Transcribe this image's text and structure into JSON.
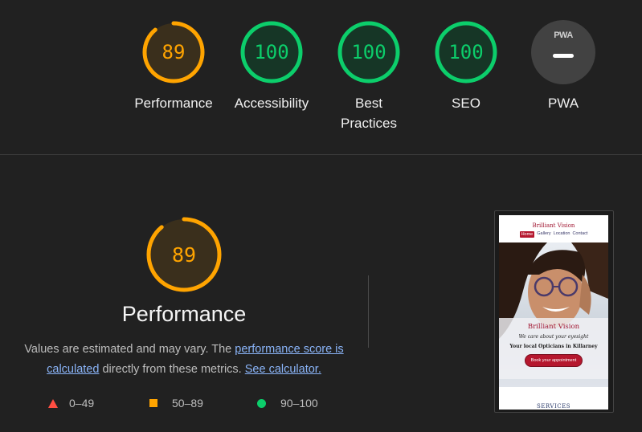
{
  "colors": {
    "average": "#ffa400",
    "pass": "#0cce6b",
    "fail": "#ff4e42",
    "link": "#8ab4f8"
  },
  "categories": [
    {
      "label": "Performance",
      "score": "89",
      "status": "average"
    },
    {
      "label": "Accessibility",
      "score": "100",
      "status": "pass"
    },
    {
      "label": "Best Practices",
      "score": "100",
      "status": "pass"
    },
    {
      "label": "SEO",
      "score": "100",
      "status": "pass"
    },
    {
      "label": "PWA",
      "badge": "PWA",
      "status": "na"
    }
  ],
  "performance": {
    "score": 89,
    "score_text": "89",
    "title": "Performance",
    "desc_before": "Values are estimated and may vary. The ",
    "link_score": "performance score is calculated",
    "desc_middle": " directly from these metrics. ",
    "link_calc": "See calculator."
  },
  "legend": [
    {
      "shape": "triangle",
      "range": "0–49"
    },
    {
      "shape": "square",
      "range": "50–89"
    },
    {
      "shape": "circle",
      "range": "90–100"
    }
  ],
  "screenshot": {
    "logo": "Brilliant Vision",
    "nav": [
      "Home",
      "Gallery",
      "Location",
      "Contact"
    ],
    "hero_title": "Brilliant Vision",
    "hero_tagline": "We care about your eyesight",
    "hero_subtitle": "Your local Opticians in Killarney",
    "cta": "Book your appointment",
    "section": "SERVICES"
  }
}
